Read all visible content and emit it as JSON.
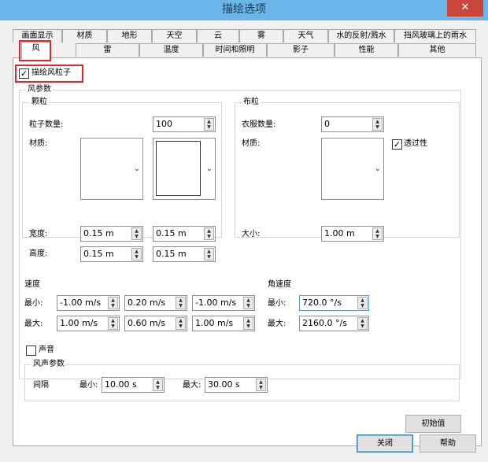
{
  "window": {
    "title": "描绘选项",
    "close_label": "✕"
  },
  "tabs_row1": [
    "画面显示",
    "材质",
    "地形",
    "天空",
    "云",
    "雾",
    "天气",
    "水的反射/溅水",
    "挡风玻璃上的雨水"
  ],
  "tabs_row2": [
    "风",
    "雷",
    "温度",
    "时间和照明",
    "影子",
    "性能",
    "其他"
  ],
  "active_tab": "风",
  "wind": {
    "draw_particles": {
      "label": "描绘风粒子",
      "checked": true
    },
    "params_title": "风参数",
    "particles": {
      "title": "颗粒",
      "count_label": "粒子数量:",
      "count_value": "100",
      "material_label": "材质:",
      "width_label": "宽度:",
      "width_values": [
        "0.15 m",
        "0.15 m"
      ],
      "height_label": "高度:",
      "height_values": [
        "0.15 m",
        "0.15 m"
      ]
    },
    "cloth": {
      "title": "布粒",
      "count_label": "衣服数量:",
      "count_value": "0",
      "material_label": "材质:",
      "transparency": {
        "label": "透过性",
        "checked": true
      },
      "size_label": "大小:",
      "size_value": "1.00 m"
    },
    "speed": {
      "title": "速度",
      "min_label": "最小:",
      "max_label": "最大:",
      "min_values": [
        "-1.00 m/s",
        "0.20 m/s",
        "-1.00 m/s"
      ],
      "max_values": [
        "1.00 m/s",
        "0.60 m/s",
        "1.00 m/s"
      ]
    },
    "angular": {
      "title": "角速度",
      "min_label": "最小:",
      "max_label": "最大:",
      "min_value": "720.0 °/s",
      "max_value": "2160.0 °/s"
    },
    "sound": {
      "label": "声音",
      "checked": false
    },
    "sound_params": {
      "title": "风声参数",
      "interval_label": "间隔",
      "min_label": "最小:",
      "min_value": "10.00 s",
      "max_label": "最大:",
      "max_value": "30.00 s"
    },
    "reset_label": "初始值"
  },
  "footer": {
    "close_label": "关闭",
    "help_label": "帮助"
  },
  "colors": {
    "titlebar": "#6ab6e8",
    "close": "#c9463d",
    "highlight": "#e0262a",
    "focus": "#5b9bd5"
  }
}
